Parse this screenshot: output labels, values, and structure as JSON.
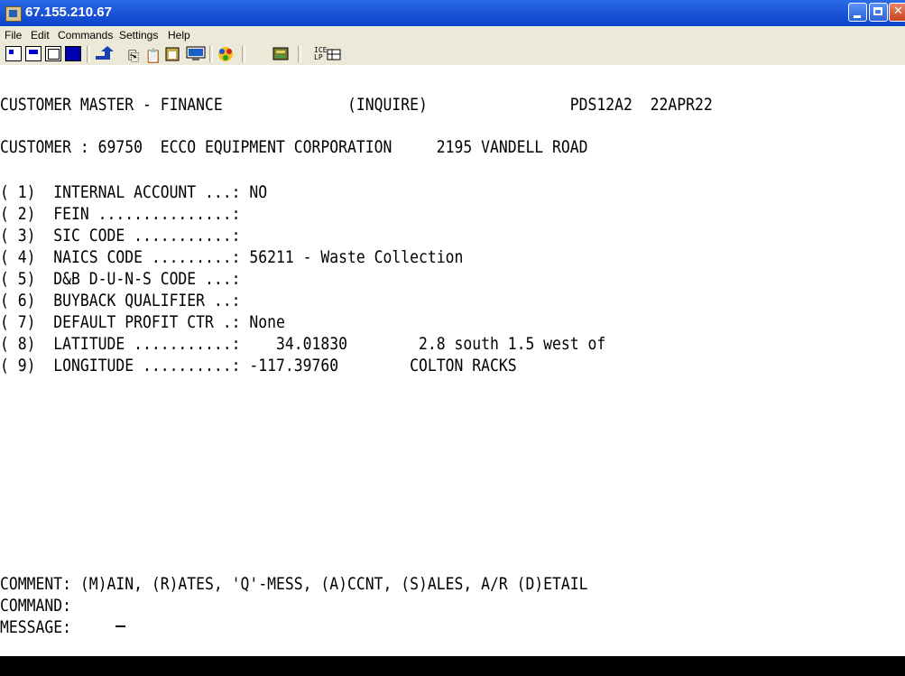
{
  "window": {
    "title": "67.155.210.67"
  },
  "menu": [
    "File",
    "Edit",
    "Commands",
    "Settings",
    "Help"
  ],
  "toolbar": {
    "icons": [
      "small-screen-icon",
      "medium-screen-icon",
      "window-icon",
      "full-screen-icon",
      "upload-icon",
      "copy-icon",
      "paste-icon",
      "clipboard-icon",
      "monitor-icon",
      "colors-icon",
      "keyboard-icon",
      "ice-lp-icon"
    ],
    "ice_label_top": "ICE",
    "ice_label_bottom": "LP"
  },
  "terminal": {
    "header": "CUSTOMER MASTER - FINANCE              (INQUIRE)                PDS12A2  22APR22",
    "customer_line": "CUSTOMER : 69750  ECCO EQUIPMENT CORPORATION     2195 VANDELL ROAD",
    "fields": [
      "( 1)  INTERNAL ACCOUNT ...: NO",
      "( 2)  FEIN ...............:",
      "( 3)  SIC CODE ...........:",
      "( 4)  NAICS CODE .........: 56211 - Waste Collection",
      "( 5)  D&B D-U-N-S CODE ...:",
      "( 6)  BUYBACK QUALIFIER ..:",
      "( 7)  DEFAULT PROFIT CTR .: None",
      "( 8)  LATITUDE ...........:    34.01830        2.8 south 1.5 west of",
      "( 9)  LONGITUDE ..........: -117.39760        COLTON RACKS"
    ],
    "comment": "COMMENT: (M)AIN, (R)ATES, 'Q'-MESS, (A)CCNT, (S)ALES, A/R (D)ETAIL",
    "command_label": "COMMAND:",
    "command_value": "",
    "message_label": "MESSAGE:"
  },
  "colors": {
    "titlebar": "#1d55d8",
    "terminal_bg": "#ffffff",
    "terminal_text": "#000000"
  }
}
